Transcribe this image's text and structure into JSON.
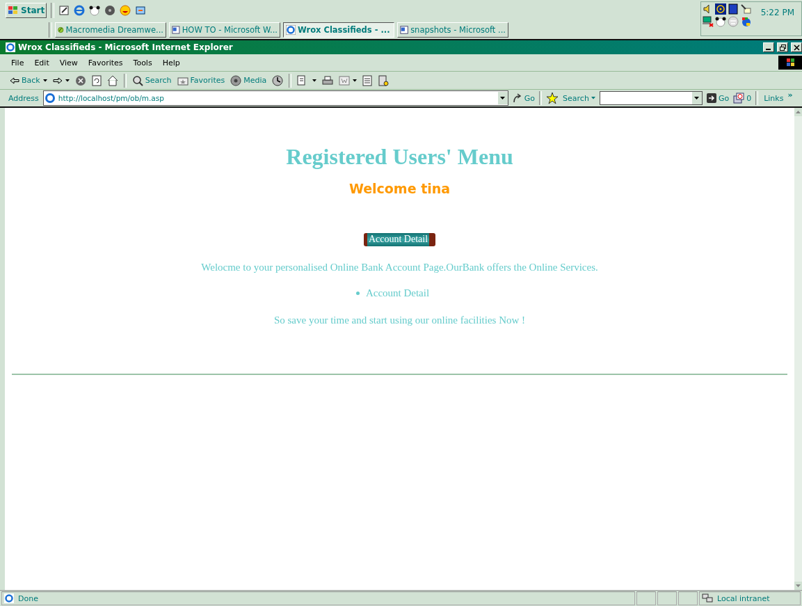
{
  "taskbar": {
    "start_label": "Start",
    "tasks": [
      {
        "label": "Macromedia Dreamwe...",
        "kind": "dreamweaver",
        "selected": false
      },
      {
        "label": "HOW TO - Microsoft W...",
        "kind": "word",
        "selected": false
      },
      {
        "label": "Wrox Classifieds - ...",
        "kind": "ie",
        "selected": true
      },
      {
        "label": "snapshots - Microsoft ...",
        "kind": "word",
        "selected": false
      }
    ],
    "clock": "5:22 PM"
  },
  "window": {
    "title": "Wrox Classifieds - Microsoft Internet Explorer"
  },
  "menu": [
    "File",
    "Edit",
    "View",
    "Favorites",
    "Tools",
    "Help"
  ],
  "toolbar": {
    "back": "Back",
    "search": "Search",
    "favorites": "Favorites",
    "media": "Media"
  },
  "address_bar": {
    "label": "Address",
    "url": "http://localhost/pm/ob/m.asp",
    "go": "Go",
    "search_label": "Search",
    "search_go": "Go",
    "popup_count": "0",
    "links": "Links",
    "more": "»"
  },
  "page": {
    "heading": "Registered Users' Menu",
    "welcome": "Welcome tina",
    "button": "Account Detail",
    "intro": "Welocme to your personalised Online Bank Account Page.OurBank offers the Online Services.",
    "list": [
      "Account Detail"
    ],
    "closing": "So save your time and start using our online facilities Now !"
  },
  "status_bar": {
    "text": "Done",
    "zone": "Local intranet"
  }
}
